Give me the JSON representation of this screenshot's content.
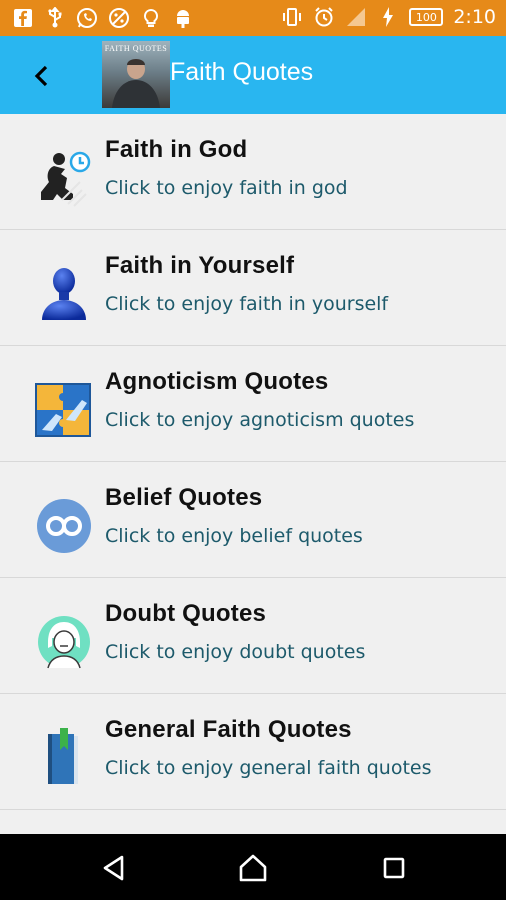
{
  "status_bar": {
    "time": "2:10",
    "battery": "100",
    "left_icons": [
      "facebook-icon",
      "usb-icon",
      "whatsapp-icon",
      "palette-icon",
      "lightbulb-icon",
      "android-icon"
    ],
    "right_icons": [
      "vibrate-icon",
      "alarm-icon",
      "signal-icon",
      "charging-icon"
    ]
  },
  "app_bar": {
    "title": "Faith Quotes",
    "logo_text": "FAITH QUOTES",
    "color": "#29b6f0"
  },
  "items": [
    {
      "title": "Faith in God",
      "subtitle": "Click to enjoy faith in god",
      "icon": "praying-person-icon"
    },
    {
      "title": "Faith in Yourself",
      "subtitle": "Click to enjoy faith in yourself",
      "icon": "person-bust-icon"
    },
    {
      "title": "Agnoticism Quotes",
      "subtitle": "Click to enjoy agnoticism quotes",
      "icon": "puzzle-hands-icon"
    },
    {
      "title": "Belief Quotes",
      "subtitle": "Click to enjoy belief quotes",
      "icon": "infinity-circle-icon"
    },
    {
      "title": "Doubt Quotes",
      "subtitle": "Click to enjoy doubt quotes",
      "icon": "doubt-face-icon"
    },
    {
      "title": "General Faith Quotes",
      "subtitle": "Click to enjoy general faith quotes",
      "icon": "book-bookmark-icon"
    }
  ],
  "nav_bar": {
    "buttons": [
      "back-icon",
      "home-icon",
      "recents-icon"
    ]
  }
}
